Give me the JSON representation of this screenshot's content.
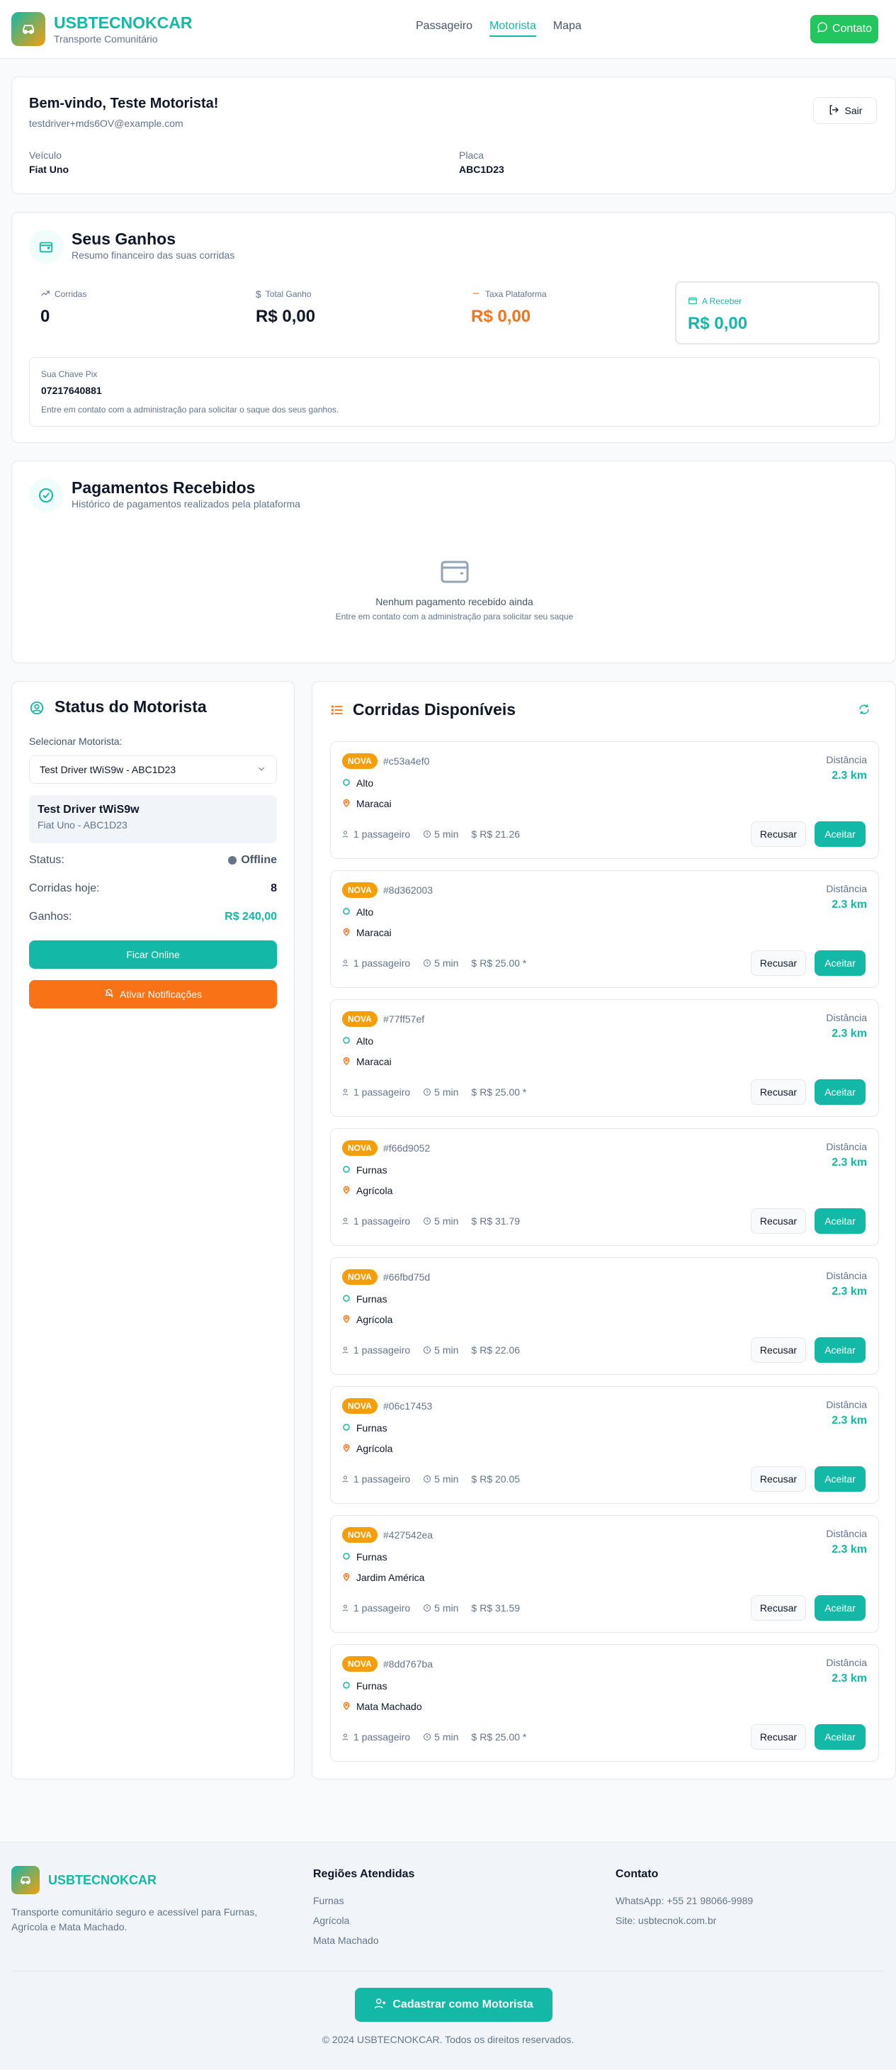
{
  "header": {
    "brand": "USBTECNOKCAR",
    "tagline": "Transporte Comunitário",
    "nav": [
      "Passageiro",
      "Motorista",
      "Mapa"
    ],
    "contact_label": "Contato"
  },
  "welcome": {
    "title": "Bem-vindo, Teste Motorista!",
    "email": "testdriver+mds6OV@example.com",
    "logout_label": "Sair",
    "vehicle_label": "Veículo",
    "vehicle_value": "Fiat Uno",
    "plate_label": "Placa",
    "plate_value": "ABC1D23"
  },
  "earnings": {
    "title": "Seus Ganhos",
    "subtitle": "Resumo financeiro das suas corridas",
    "rides_label": "Corridas",
    "rides_value": "0",
    "total_label": "Total Ganho",
    "total_value": "R$ 0,00",
    "fee_label": "Taxa Plataforma",
    "fee_value": "R$ 0,00",
    "receivable_label": "A Receber",
    "receivable_value": "R$ 0,00",
    "pix_label": "Sua Chave Pix",
    "pix_value": "07217640881",
    "pix_note": "Entre em contato com a administração para solicitar o saque dos seus ganhos."
  },
  "payments": {
    "title": "Pagamentos Recebidos",
    "subtitle": "Histórico de pagamentos realizados pela plataforma",
    "empty_title": "Nenhum pagamento recebido ainda",
    "empty_sub": "Entre em contato com a administração para solicitar seu saque"
  },
  "driver_status": {
    "title": "Status do Motorista",
    "select_label": "Selecionar Motorista:",
    "select_value": "Test Driver tWiS9w - ABC1D23",
    "driver_name": "Test Driver tWiS9w",
    "driver_vehicle": "Fiat Uno - ABC1D23",
    "status_label": "Status:",
    "status_value": "Offline",
    "rides_today_label": "Corridas hoje:",
    "rides_today_value": "8",
    "earnings_label": "Ganhos:",
    "earnings_value": "R$ 240,00",
    "online_button": "Ficar Online",
    "notify_button": "Ativar Notificações"
  },
  "rides": {
    "title": "Corridas Disponíveis",
    "badge": "NOVA",
    "distance_label": "Distância",
    "decline_label": "Recusar",
    "accept_label": "Aceitar",
    "items": [
      {
        "id": "#c53a4ef0",
        "from": "Alto",
        "to": "Maracai",
        "passengers": "1 passageiro",
        "time": "5 min",
        "price": "R$ 21.26",
        "distance": "2.3 km"
      },
      {
        "id": "#8d362003",
        "from": "Alto",
        "to": "Maracai",
        "passengers": "1 passageiro",
        "time": "5 min",
        "price": "R$ 25.00 *",
        "distance": "2.3 km"
      },
      {
        "id": "#77ff57ef",
        "from": "Alto",
        "to": "Maracai",
        "passengers": "1 passageiro",
        "time": "5 min",
        "price": "R$ 25.00 *",
        "distance": "2.3 km"
      },
      {
        "id": "#f66d9052",
        "from": "Furnas",
        "to": "Agrícola",
        "passengers": "1 passageiro",
        "time": "5 min",
        "price": "R$ 31.79",
        "distance": "2.3 km"
      },
      {
        "id": "#66fbd75d",
        "from": "Furnas",
        "to": "Agrícola",
        "passengers": "1 passageiro",
        "time": "5 min",
        "price": "R$ 22.06",
        "distance": "2.3 km"
      },
      {
        "id": "#06c17453",
        "from": "Furnas",
        "to": "Agrícola",
        "passengers": "1 passageiro",
        "time": "5 min",
        "price": "R$ 20.05",
        "distance": "2.3 km"
      },
      {
        "id": "#427542ea",
        "from": "Furnas",
        "to": "Jardim América",
        "passengers": "1 passageiro",
        "time": "5 min",
        "price": "R$ 31.59",
        "distance": "2.3 km"
      },
      {
        "id": "#8dd767ba",
        "from": "Furnas",
        "to": "Mata Machado",
        "passengers": "1 passageiro",
        "time": "5 min",
        "price": "R$ 25.00 *",
        "distance": "2.3 km"
      }
    ]
  },
  "footer": {
    "brand": "USBTECNOKCAR",
    "description": "Transporte comunitário seguro e acessível para Furnas, Agrícola e Mata Machado.",
    "regions_title": "Regiões Atendidas",
    "regions": [
      "Furnas",
      "Agrícola",
      "Mata Machado"
    ],
    "contact_title": "Contato",
    "whatsapp": "WhatsApp: +55 21 98066-9989",
    "site": "Site: usbtecnok.com.br",
    "register_button": "Cadastrar como Motorista",
    "copyright": "© 2024 USBTECNOKCAR. Todos os direitos reservados."
  },
  "colors": {
    "primary": "#14b8a6",
    "accent": "#f59e0b",
    "orange": "#f97316",
    "whatsapp": "#22c55e"
  }
}
